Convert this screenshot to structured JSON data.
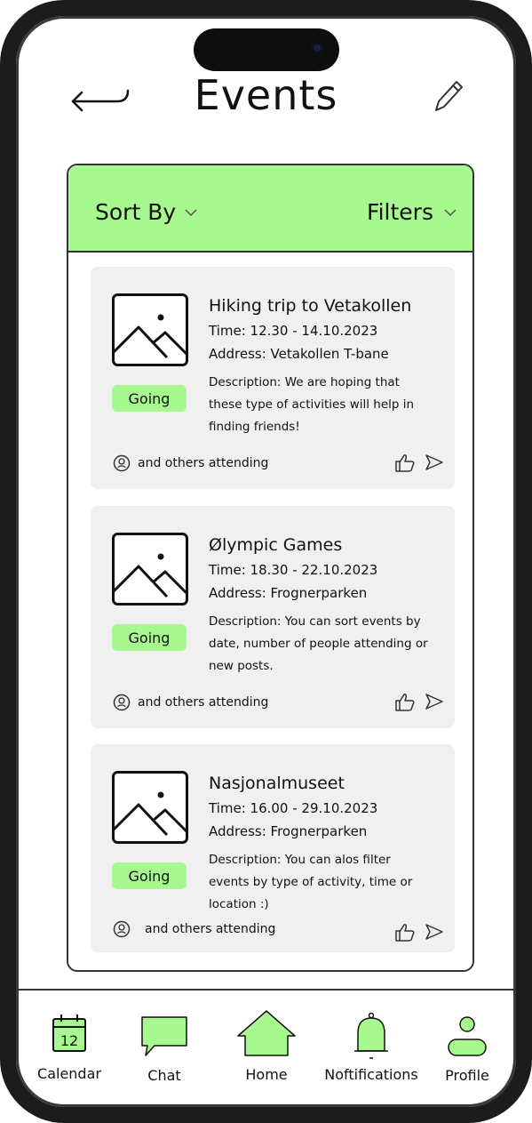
{
  "header": {
    "title": "Events",
    "back_icon": "arrow-left-icon",
    "edit_icon": "pencil-icon"
  },
  "toolbar": {
    "sort_label": "Sort By",
    "filters_label": "Filters"
  },
  "events": [
    {
      "title": "Hiking trip to Vetakollen",
      "time": "Time: 12.30 - 14.10.2023",
      "address": "Address: Vetakollen T-bane",
      "description": "Description: We are hoping that these type of activities will help in finding friends!",
      "status": "Going",
      "attending": "and others attending"
    },
    {
      "title": "Ølympic Games",
      "time": "Time: 18.30 - 22.10.2023",
      "address": "Address: Frognerparken",
      "description": "Description: You can sort events by date, number of people attending or new posts.",
      "status": "Going",
      "attending": "and others attending"
    },
    {
      "title": "Nasjonalmuseet",
      "time": "Time: 16.00 - 29.10.2023",
      "address": "Address: Frognerparken",
      "description": "Description: You can alos filter events by type of activity, time or location :)",
      "status": "Going",
      "attending": "and others attending"
    }
  ],
  "bottom_nav": {
    "calendar": {
      "label": "Calendar",
      "day": "12",
      "icon": "calendar-icon"
    },
    "chat": {
      "label": "Chat",
      "icon": "chat-bubble-icon"
    },
    "home": {
      "label": "Home",
      "icon": "home-icon"
    },
    "notifications": {
      "label": "Noftifications",
      "icon": "bell-icon"
    },
    "profile": {
      "label": "Profile",
      "icon": "person-icon"
    }
  },
  "colors": {
    "accent": "#a6f88f",
    "card": "#f0f0f0",
    "frame": "#1c1c1c"
  }
}
